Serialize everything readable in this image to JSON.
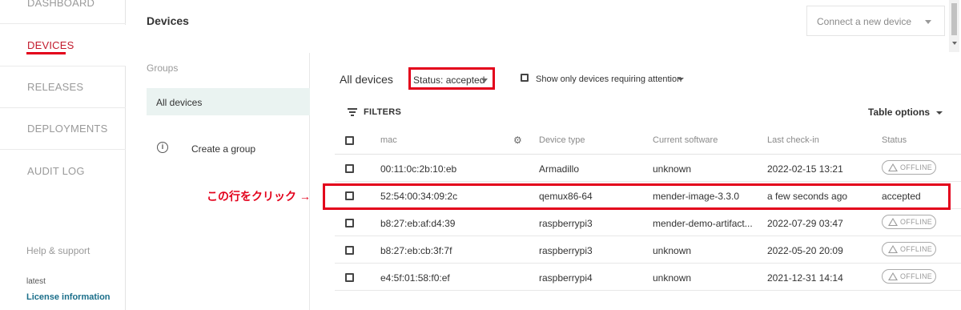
{
  "sidebar": {
    "items": [
      {
        "label": "DASHBOARD"
      },
      {
        "label": "DEVICES"
      },
      {
        "label": "RELEASES"
      },
      {
        "label": "DEPLOYMENTS"
      },
      {
        "label": "AUDIT LOG"
      }
    ],
    "help": "Help & support",
    "version": "latest",
    "license": "License information"
  },
  "header": {
    "title": "Devices",
    "connect_placeholder": "Connect a new device"
  },
  "groups": {
    "title": "Groups",
    "all_devices": "All devices",
    "create_group": "Create a group"
  },
  "content": {
    "title": "All devices",
    "status_label": "Status:",
    "status_value": "accepted",
    "attention_label": "Show only devices requiring attention",
    "filters_label": "FILTERS",
    "table_options": "Table options"
  },
  "table": {
    "columns": [
      "mac",
      "Device type",
      "Current software",
      "Last check-in",
      "Status"
    ],
    "rows": [
      {
        "mac": "00:11:0c:2b:10:eb",
        "type": "Armadillo",
        "software": "unknown",
        "checkin": "2022-02-15 13:21",
        "status": "OFFLINE"
      },
      {
        "mac": "52:54:00:34:09:2c",
        "type": "qemux86-64",
        "software": "mender-image-3.3.0",
        "checkin": "a few seconds ago",
        "status": "accepted"
      },
      {
        "mac": "b8:27:eb:af:d4:39",
        "type": "raspberrypi3",
        "software": "mender-demo-artifact...",
        "checkin": "2022-07-29 03:47",
        "status": "OFFLINE"
      },
      {
        "mac": "b8:27:eb:cb:3f:7f",
        "type": "raspberrypi3",
        "software": "unknown",
        "checkin": "2022-05-20 20:09",
        "status": "OFFLINE"
      },
      {
        "mac": "e4:5f:01:58:f0:ef",
        "type": "raspberrypi4",
        "software": "unknown",
        "checkin": "2021-12-31 14:14",
        "status": "OFFLINE"
      }
    ]
  },
  "annotation": "この行をクリック →",
  "colors": {
    "accent": "#e3001b",
    "selected_group_bg": "#eaf3f1"
  }
}
